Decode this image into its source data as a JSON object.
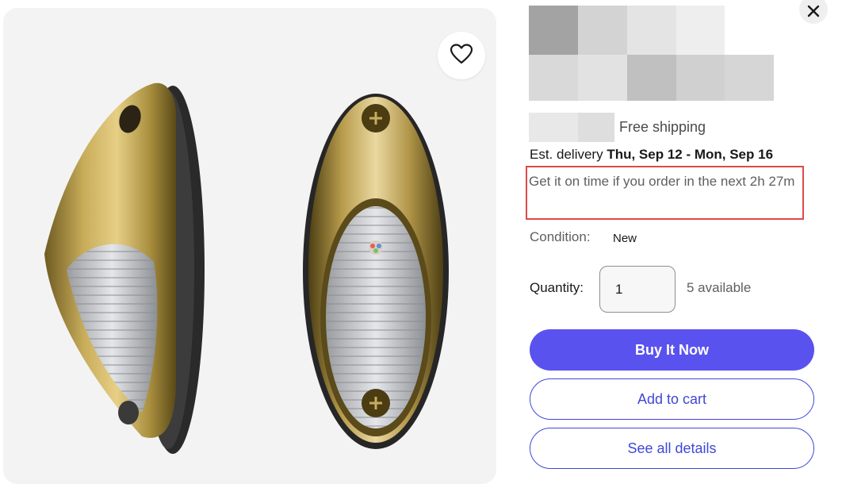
{
  "icons": {
    "favorite": "heart-outline-icon",
    "close": "close-x-icon"
  },
  "colors": {
    "accent": "#5a52ef",
    "outline": "#3f48d6",
    "highlight_box": "#e04848"
  },
  "listing": {
    "shipping": "Free shipping",
    "delivery_prefix": "Est. delivery",
    "delivery_dates": "Thu, Sep 12 - Mon, Sep 16",
    "ontime_text": "Get it on time if you order in the next 2h 27m",
    "condition_label": "Condition:",
    "condition_value": "New",
    "quantity_label": "Quantity:",
    "quantity_value": "1",
    "available": "5 available"
  },
  "actions": {
    "buy_now": "Buy It Now",
    "add_to_cart": "Add to cart",
    "see_details": "See all details"
  }
}
